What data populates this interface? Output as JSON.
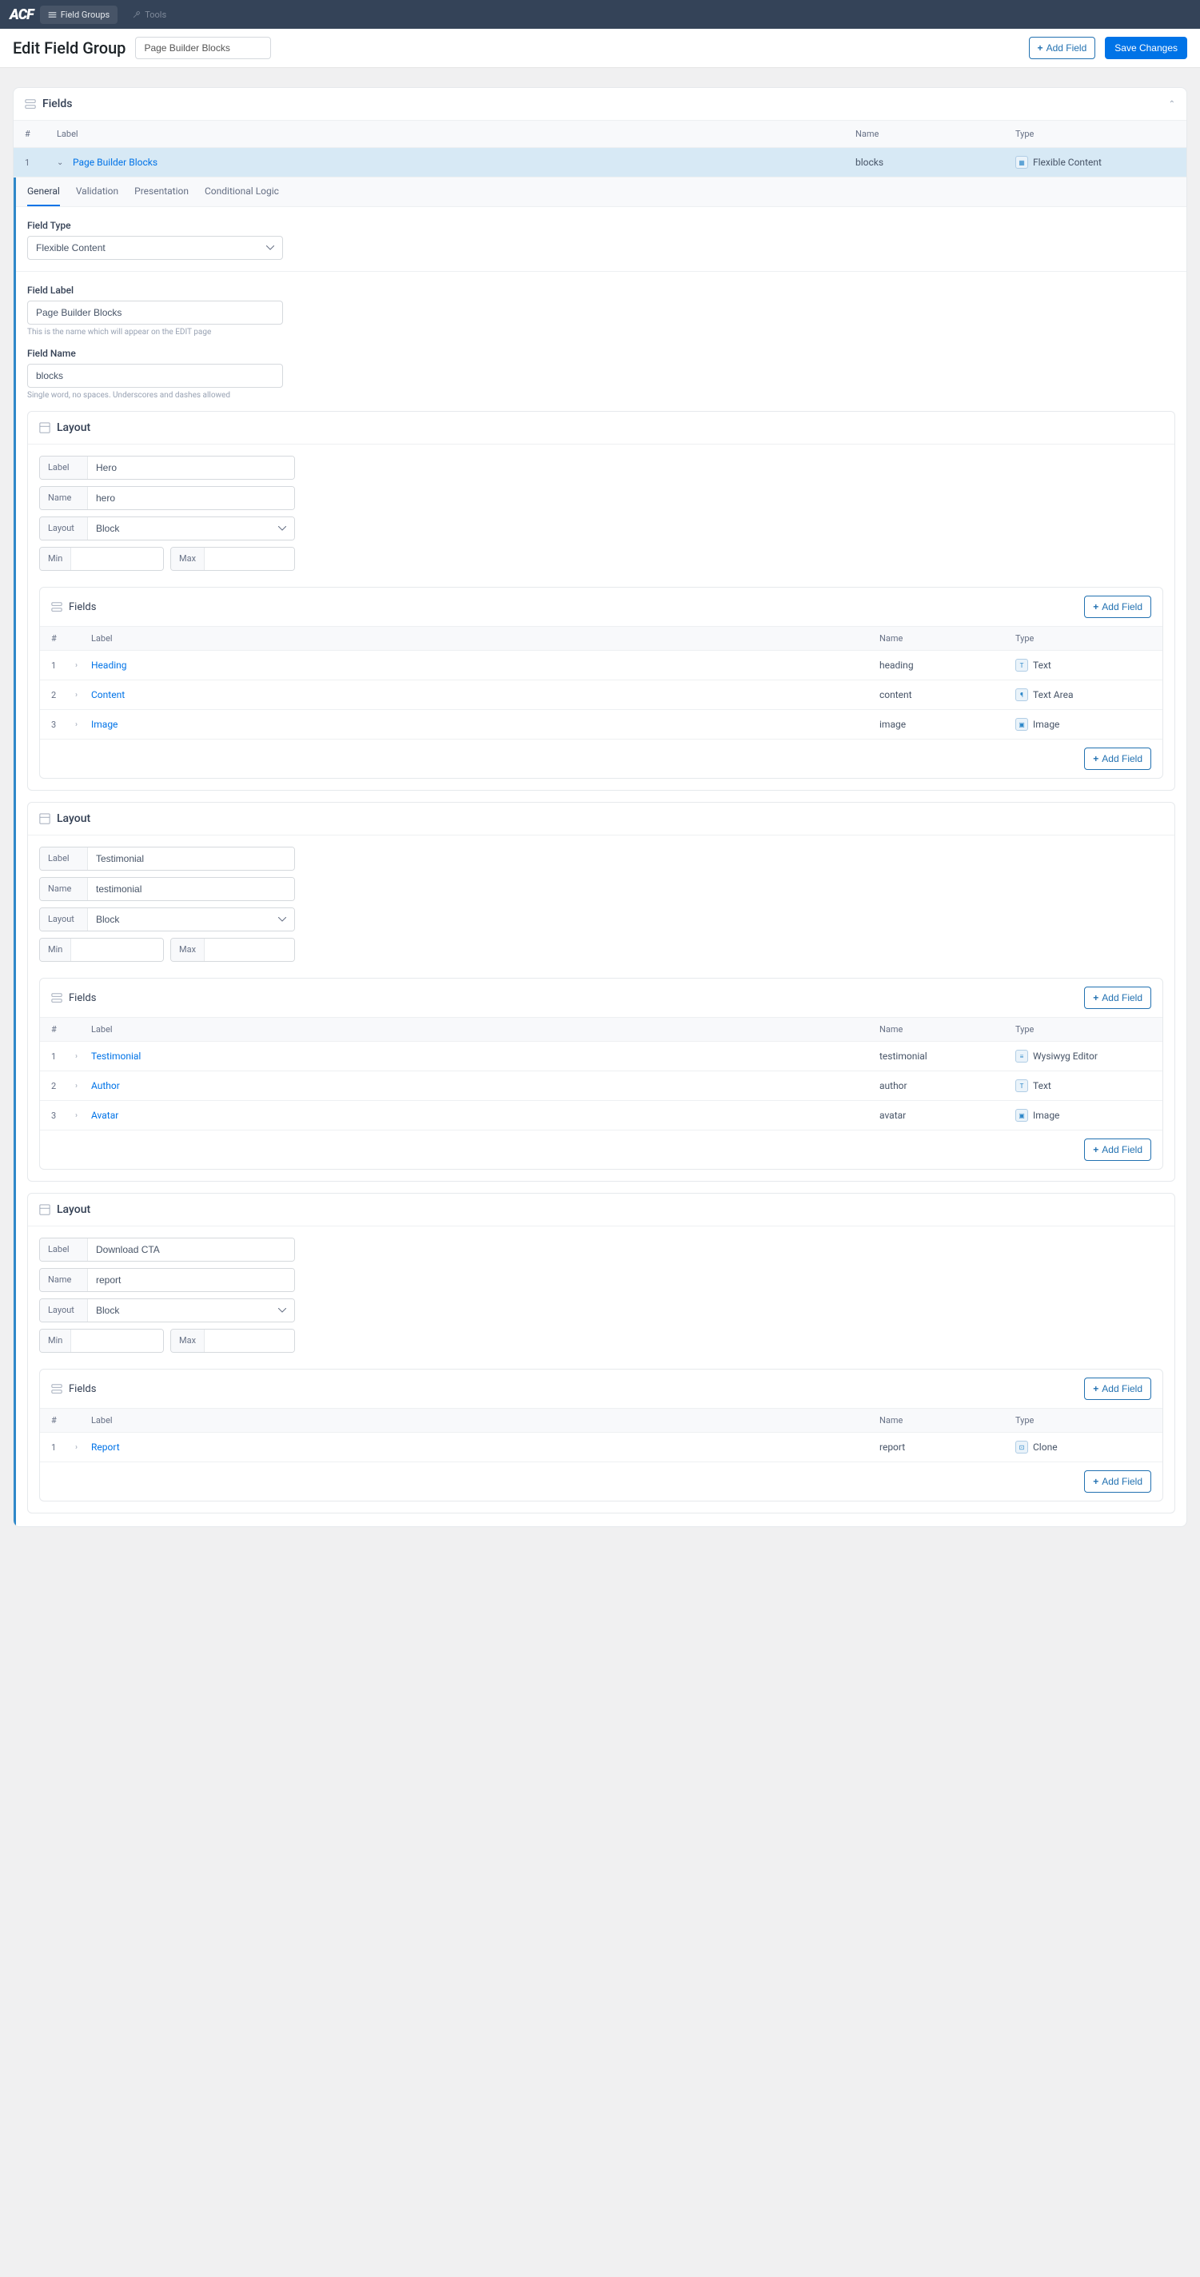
{
  "nav": {
    "logo": "ACF",
    "field_groups": "Field Groups",
    "tools": "Tools"
  },
  "header": {
    "title": "Edit Field Group",
    "input_value": "Page Builder Blocks",
    "add_field": "Add Field",
    "save": "Save Changes"
  },
  "section": {
    "title": "Fields",
    "cols": {
      "num": "#",
      "label": "Label",
      "name": "Name",
      "type": "Type"
    }
  },
  "main_field": {
    "num": "1",
    "label": "Page Builder Blocks",
    "name": "blocks",
    "type": "Flexible Content"
  },
  "tabs": {
    "general": "General",
    "validation": "Validation",
    "presentation": "Presentation",
    "conditional": "Conditional Logic"
  },
  "settings": {
    "field_type_label": "Field Type",
    "field_type_value": "Flexible Content",
    "field_label_label": "Field Label",
    "field_label_value": "Page Builder Blocks",
    "field_label_hint": "This is the name which will appear on the EDIT page",
    "field_name_label": "Field Name",
    "field_name_value": "blocks",
    "field_name_hint": "Single word, no spaces. Underscores and dashes allowed"
  },
  "layout_labels": {
    "section": "Layout",
    "label": "Label",
    "name": "Name",
    "layout": "Layout",
    "min": "Min",
    "max": "Max",
    "fields": "Fields",
    "add_field": "Add Field",
    "num": "#",
    "col_label": "Label",
    "col_name": "Name",
    "col_type": "Type"
  },
  "layouts": [
    {
      "label": "Hero",
      "name": "hero",
      "layout": "Block",
      "fields": [
        {
          "num": "1",
          "label": "Heading",
          "name": "heading",
          "type": "Text",
          "icon": "T"
        },
        {
          "num": "2",
          "label": "Content",
          "name": "content",
          "type": "Text Area",
          "icon": "¶"
        },
        {
          "num": "3",
          "label": "Image",
          "name": "image",
          "type": "Image",
          "icon": "▣"
        }
      ]
    },
    {
      "label": "Testimonial",
      "name": "testimonial",
      "layout": "Block",
      "fields": [
        {
          "num": "1",
          "label": "Testimonial",
          "name": "testimonial",
          "type": "Wysiwyg Editor",
          "icon": "≡"
        },
        {
          "num": "2",
          "label": "Author",
          "name": "author",
          "type": "Text",
          "icon": "T"
        },
        {
          "num": "3",
          "label": "Avatar",
          "name": "avatar",
          "type": "Image",
          "icon": "▣"
        }
      ]
    },
    {
      "label": "Download CTA",
      "name": "report",
      "layout": "Block",
      "fields": [
        {
          "num": "1",
          "label": "Report",
          "name": "report",
          "type": "Clone",
          "icon": "⊡"
        }
      ]
    }
  ]
}
